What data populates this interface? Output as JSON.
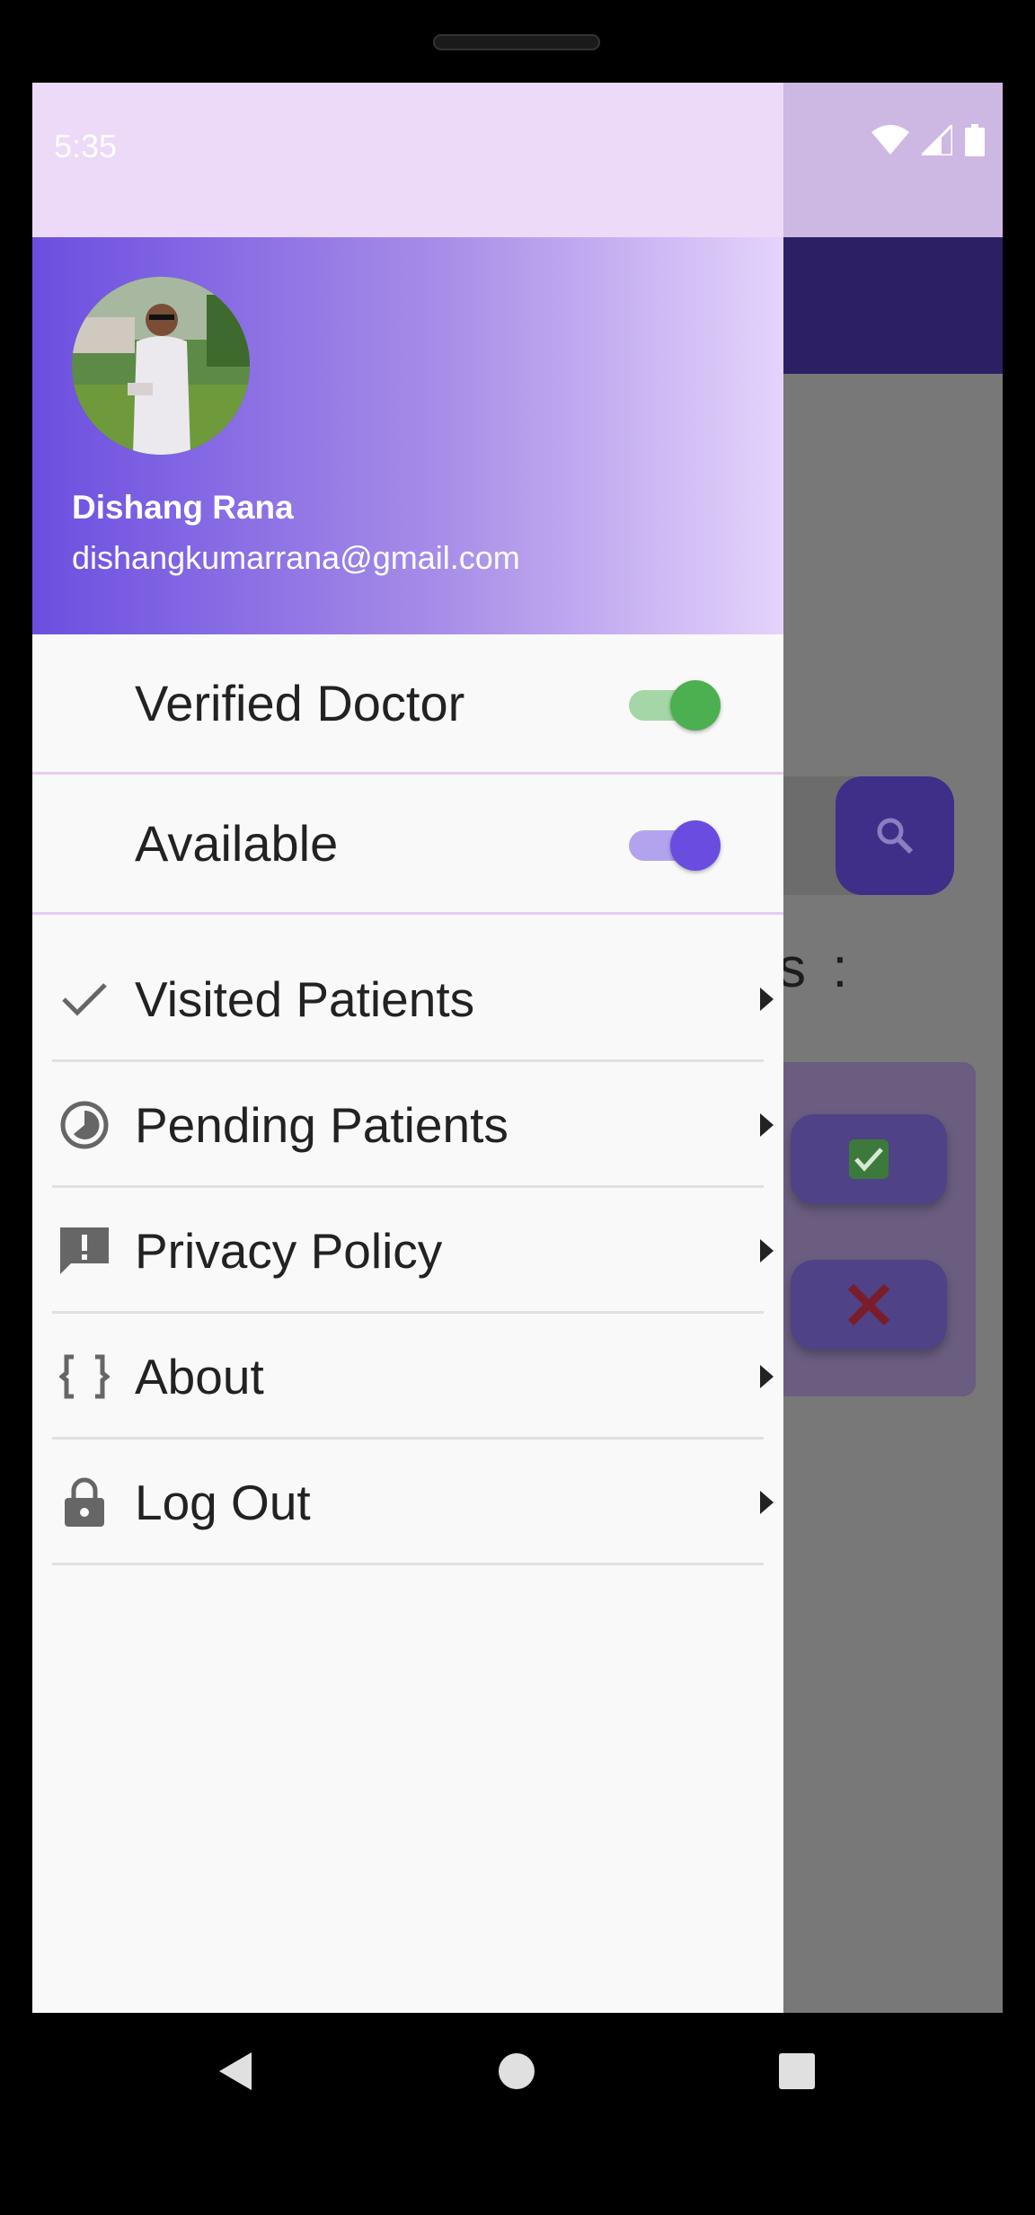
{
  "status_bar": {
    "time": "5:35"
  },
  "drawer": {
    "user": {
      "name": "Dishang Rana",
      "email": "dishangkumarrana@gmail.com"
    },
    "toggles": [
      {
        "label": "Verified Doctor",
        "on": true,
        "color": "#4caf50",
        "track_color": "#a5d6a7"
      },
      {
        "label": "Available",
        "on": true,
        "color": "#6a4de0",
        "track_color": "#b3a3ee"
      }
    ],
    "menu": [
      {
        "label": "Visited Patients",
        "icon": "check-icon"
      },
      {
        "label": "Pending Patients",
        "icon": "pie-clock-icon"
      },
      {
        "label": "Privacy Policy",
        "icon": "report-icon"
      },
      {
        "label": "About",
        "icon": "braces-icon"
      },
      {
        "label": "Log Out",
        "icon": "lock-icon"
      }
    ]
  },
  "background_app": {
    "heading_fragment": "s :",
    "accept_icon": "check-box-icon",
    "reject_icon": "x-mark-icon"
  },
  "colors": {
    "primary": "#6a4de0",
    "appbar": "#2c1f63",
    "status_bar": "#ecdaf8"
  }
}
